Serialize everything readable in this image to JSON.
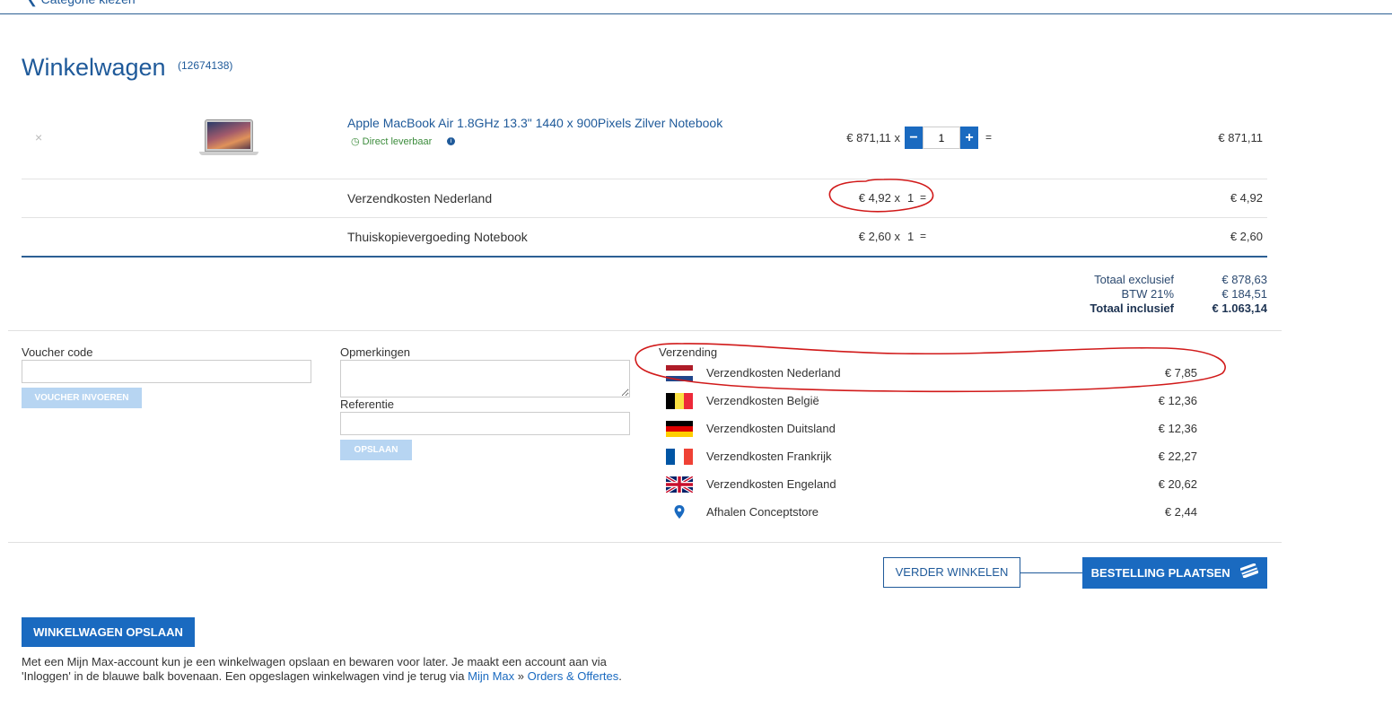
{
  "breadcrumb": {
    "back_label": "❮ Categorie kiezen"
  },
  "cart": {
    "title": "Winkelwagen",
    "id": "(12674138)"
  },
  "product": {
    "remove_icon": "×",
    "name": "Apple MacBook Air 1.8GHz 13.3\" 1440 x 900Pixels Zilver Notebook",
    "stock": "Direct leverbaar",
    "unit_price": "€ 871,11 x",
    "quantity": "1",
    "equals": "=",
    "total": "€ 871,11"
  },
  "lines": [
    {
      "label": "Verzendkosten Nederland",
      "unit_price": "€ 4,92 x",
      "qty": "1",
      "equals": "=",
      "total": "€ 4,92"
    },
    {
      "label": "Thuiskopievergoeding Notebook",
      "unit_price": "€ 2,60 x",
      "qty": "1",
      "equals": "=",
      "total": "€ 2,60"
    }
  ],
  "summary": {
    "excl_label": "Totaal exclusief",
    "excl_value": "€ 878,63",
    "vat_label": "BTW 21%",
    "vat_value": "€ 184,51",
    "incl_label": "Totaal inclusief",
    "incl_value": "€ 1.063,14"
  },
  "voucher": {
    "label": "Voucher code",
    "value": "",
    "button": "VOUCHER INVOEREN"
  },
  "remarks": {
    "label": "Opmerkingen",
    "value": "",
    "reference_label": "Referentie",
    "reference_value": "",
    "save_button": "OPSLAAN"
  },
  "shipping": {
    "title": "Verzending",
    "options": [
      {
        "name": "Verzendkosten Nederland",
        "price": "€ 7,85",
        "icon": "flag-nl-icon"
      },
      {
        "name": "Verzendkosten België",
        "price": "€ 12,36",
        "icon": "flag-be-icon"
      },
      {
        "name": "Verzendkosten Duitsland",
        "price": "€ 12,36",
        "icon": "flag-de-icon"
      },
      {
        "name": "Verzendkosten Frankrijk",
        "price": "€ 22,27",
        "icon": "flag-fr-icon"
      },
      {
        "name": "Verzendkosten Engeland",
        "price": "€ 20,62",
        "icon": "flag-gb-icon"
      },
      {
        "name": "Afhalen Conceptstore",
        "price": "€ 2,44",
        "icon": "map-pin-icon"
      }
    ]
  },
  "actions": {
    "continue_label": "VERDER WINKELEN",
    "order_label": "BESTELLING PLAATSEN",
    "save_cart_label": "WINKELWAGEN OPSLAAN"
  },
  "save_info": {
    "text_before": "Met een Mijn Max-account kun je een winkelwagen opslaan en bewaren voor later. Je maakt een account aan via 'Inloggen' in de blauwe balk bovenaan. Een opgeslagen winkelwagen vind je terug via ",
    "link1": "Mijn Max",
    "separator": " » ",
    "link2": "Orders & Offertes",
    "text_after": "."
  },
  "colors": {
    "brand_blue": "#1a6ac0",
    "heading_blue": "#1f5a9a",
    "stock_green": "#3c8c3c",
    "annotation_red": "#d11a1a"
  }
}
